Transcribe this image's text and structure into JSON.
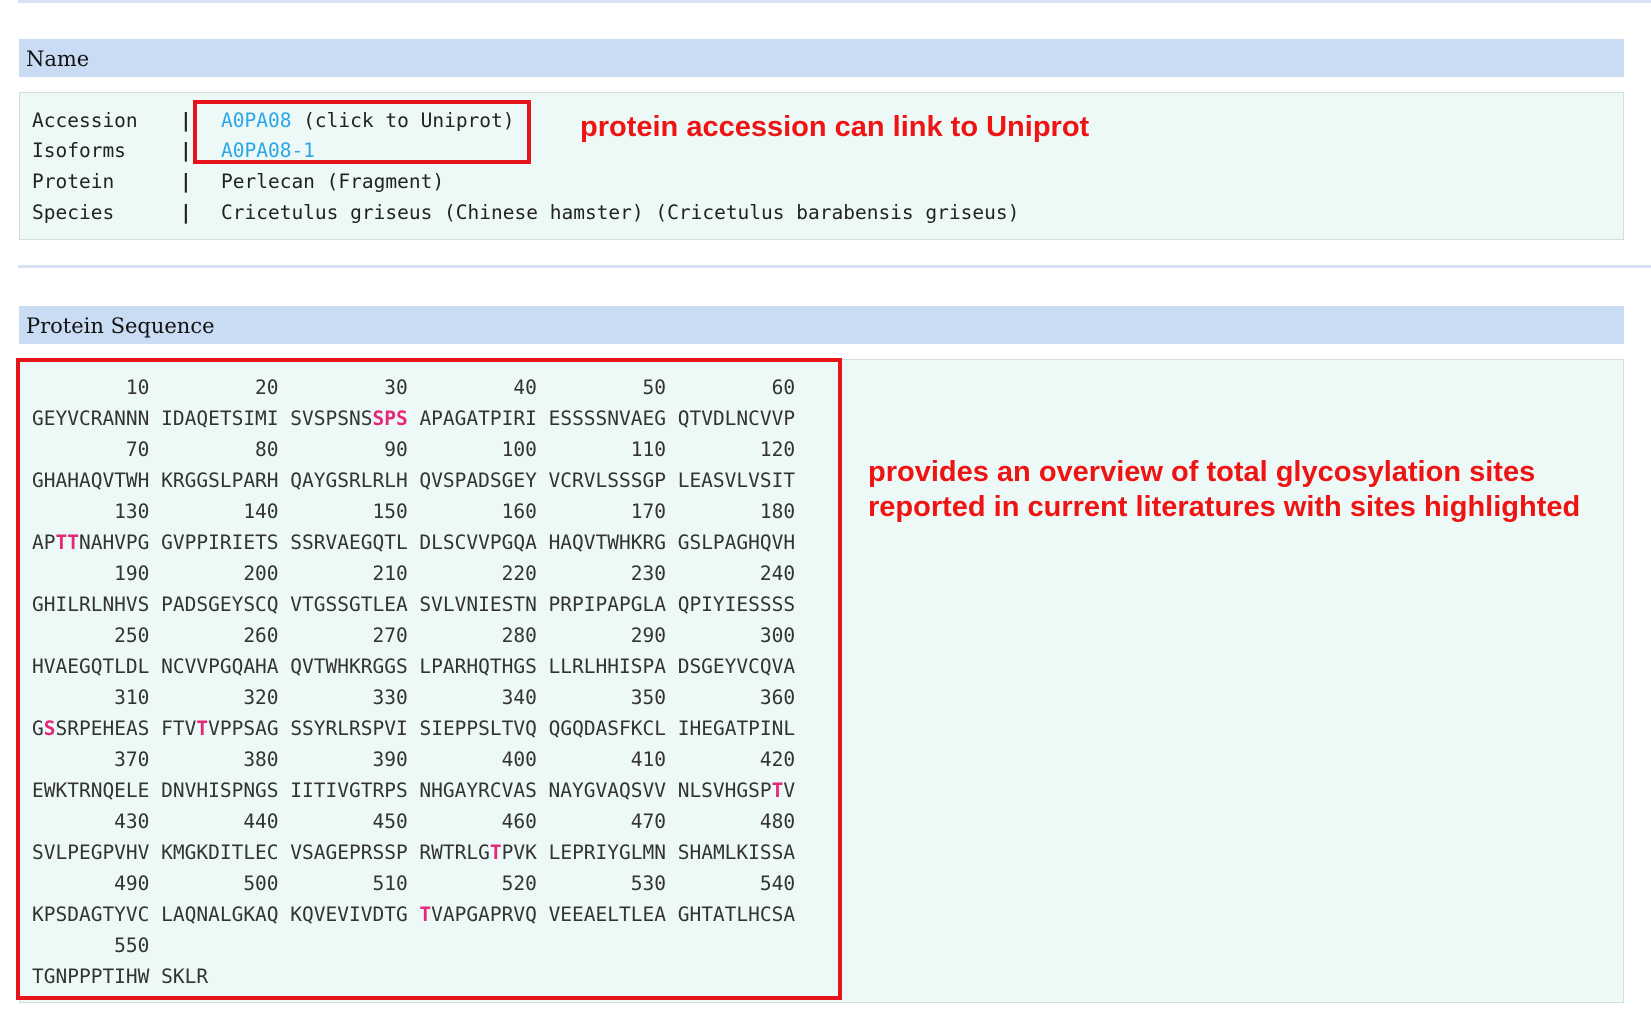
{
  "name_section": {
    "title": "Name",
    "rows": [
      {
        "label": "Accession",
        "separator": "|",
        "value_link": "A0PA08",
        "value_text": " (click to Uniprot)"
      },
      {
        "label": "Isoforms",
        "separator": "|",
        "value_link": "A0PA08-1",
        "value_text": ""
      },
      {
        "label": "Protein",
        "separator": "|",
        "value_link": "",
        "value_text": "Perlecan (Fragment)"
      },
      {
        "label": "Species",
        "separator": "|",
        "value_link": "",
        "value_text": "Cricetulus griseus (Chinese hamster) (Cricetulus barabensis griseus)"
      }
    ],
    "annotation": "protein accession can link to Uniprot"
  },
  "sequence_section": {
    "title": "Protein Sequence",
    "annotation_line1": "provides an overview of total glycosylation sites",
    "annotation_line2": "reported in current literatures with sites highlighted",
    "lines": [
      {
        "numbers": "        10         20         30         40         50         60",
        "segments": [
          {
            "t": "GEYVCRANNN IDAQETSIMI SVSPSNS"
          },
          {
            "t": "SPS",
            "site": true
          },
          {
            "t": " APAGATPIRI ESSSSNVAEG QTVDLNCVVP"
          }
        ]
      },
      {
        "numbers": "        70         80         90        100        110        120",
        "segments": [
          {
            "t": "GHAHAQVTWH KRGGSLPARH QAYGSRLRLH QVSPADSGEY VCRVLSSSGP LEASVLVSIT"
          }
        ]
      },
      {
        "numbers": "       130        140        150        160        170        180",
        "segments": [
          {
            "t": "AP"
          },
          {
            "t": "TT",
            "site": true
          },
          {
            "t": "NAHVPG GVPPIRIETS SSRVAEGQTL DLSCVVPGQA HAQVTWHKRG GSLPAGHQVH"
          }
        ]
      },
      {
        "numbers": "       190        200        210        220        230        240",
        "segments": [
          {
            "t": "GHILRLNHVS PADSGEYSCQ VTGSSGTLEA SVLVNIESTN PRPIPAPGLA QPIYIESSSS"
          }
        ]
      },
      {
        "numbers": "       250        260        270        280        290        300",
        "segments": [
          {
            "t": "HVAEGQTLDL NCVVPGQAHA QVTWHKRGGS LPARHQTHGS LLRLHHISPA DSGEYVCQVA"
          }
        ]
      },
      {
        "numbers": "       310        320        330        340        350        360",
        "segments": [
          {
            "t": "G"
          },
          {
            "t": "S",
            "site": true
          },
          {
            "t": "SRPEHEAS FTV"
          },
          {
            "t": "T",
            "site": true
          },
          {
            "t": "VPPSAG SSYRLRSPVI SIEPPSLTVQ QGQDASFKCL IHEGATPINL"
          }
        ]
      },
      {
        "numbers": "       370        380        390        400        410        420",
        "segments": [
          {
            "t": "EWKTRNQELE DNVHISPNGS IITIVGTRPS NHGAYRCVAS NAYGVAQSVV NLSVHGSP"
          },
          {
            "t": "T",
            "site": true
          },
          {
            "t": "V"
          }
        ]
      },
      {
        "numbers": "       430        440        450        460        470        480",
        "segments": [
          {
            "t": "SVLPEGPVHV KMGKDITLEC VSAGEPRSSP RWTRLG"
          },
          {
            "t": "T",
            "site": true
          },
          {
            "t": "PVK LEPRIYGLMN SHAMLKISSA"
          }
        ]
      },
      {
        "numbers": "       490        500        510        520        530        540",
        "segments": [
          {
            "t": "KPSDAGTYVC LAQNALGKAQ KQVEVIVDTG "
          },
          {
            "t": "T",
            "site": true
          },
          {
            "t": "VAPGAPRVQ VEEAELTLEA GHTATLHCSA"
          }
        ]
      },
      {
        "numbers": "       550",
        "segments": [
          {
            "t": "TGNPPPTIHW SKLR"
          }
        ]
      }
    ]
  },
  "colors": {
    "header_bg": "#cadcf4",
    "panel_bg": "#ecf9f6",
    "link": "#2ba6e6",
    "site_highlight": "#e6287a",
    "annotation_red": "#ee1414"
  }
}
